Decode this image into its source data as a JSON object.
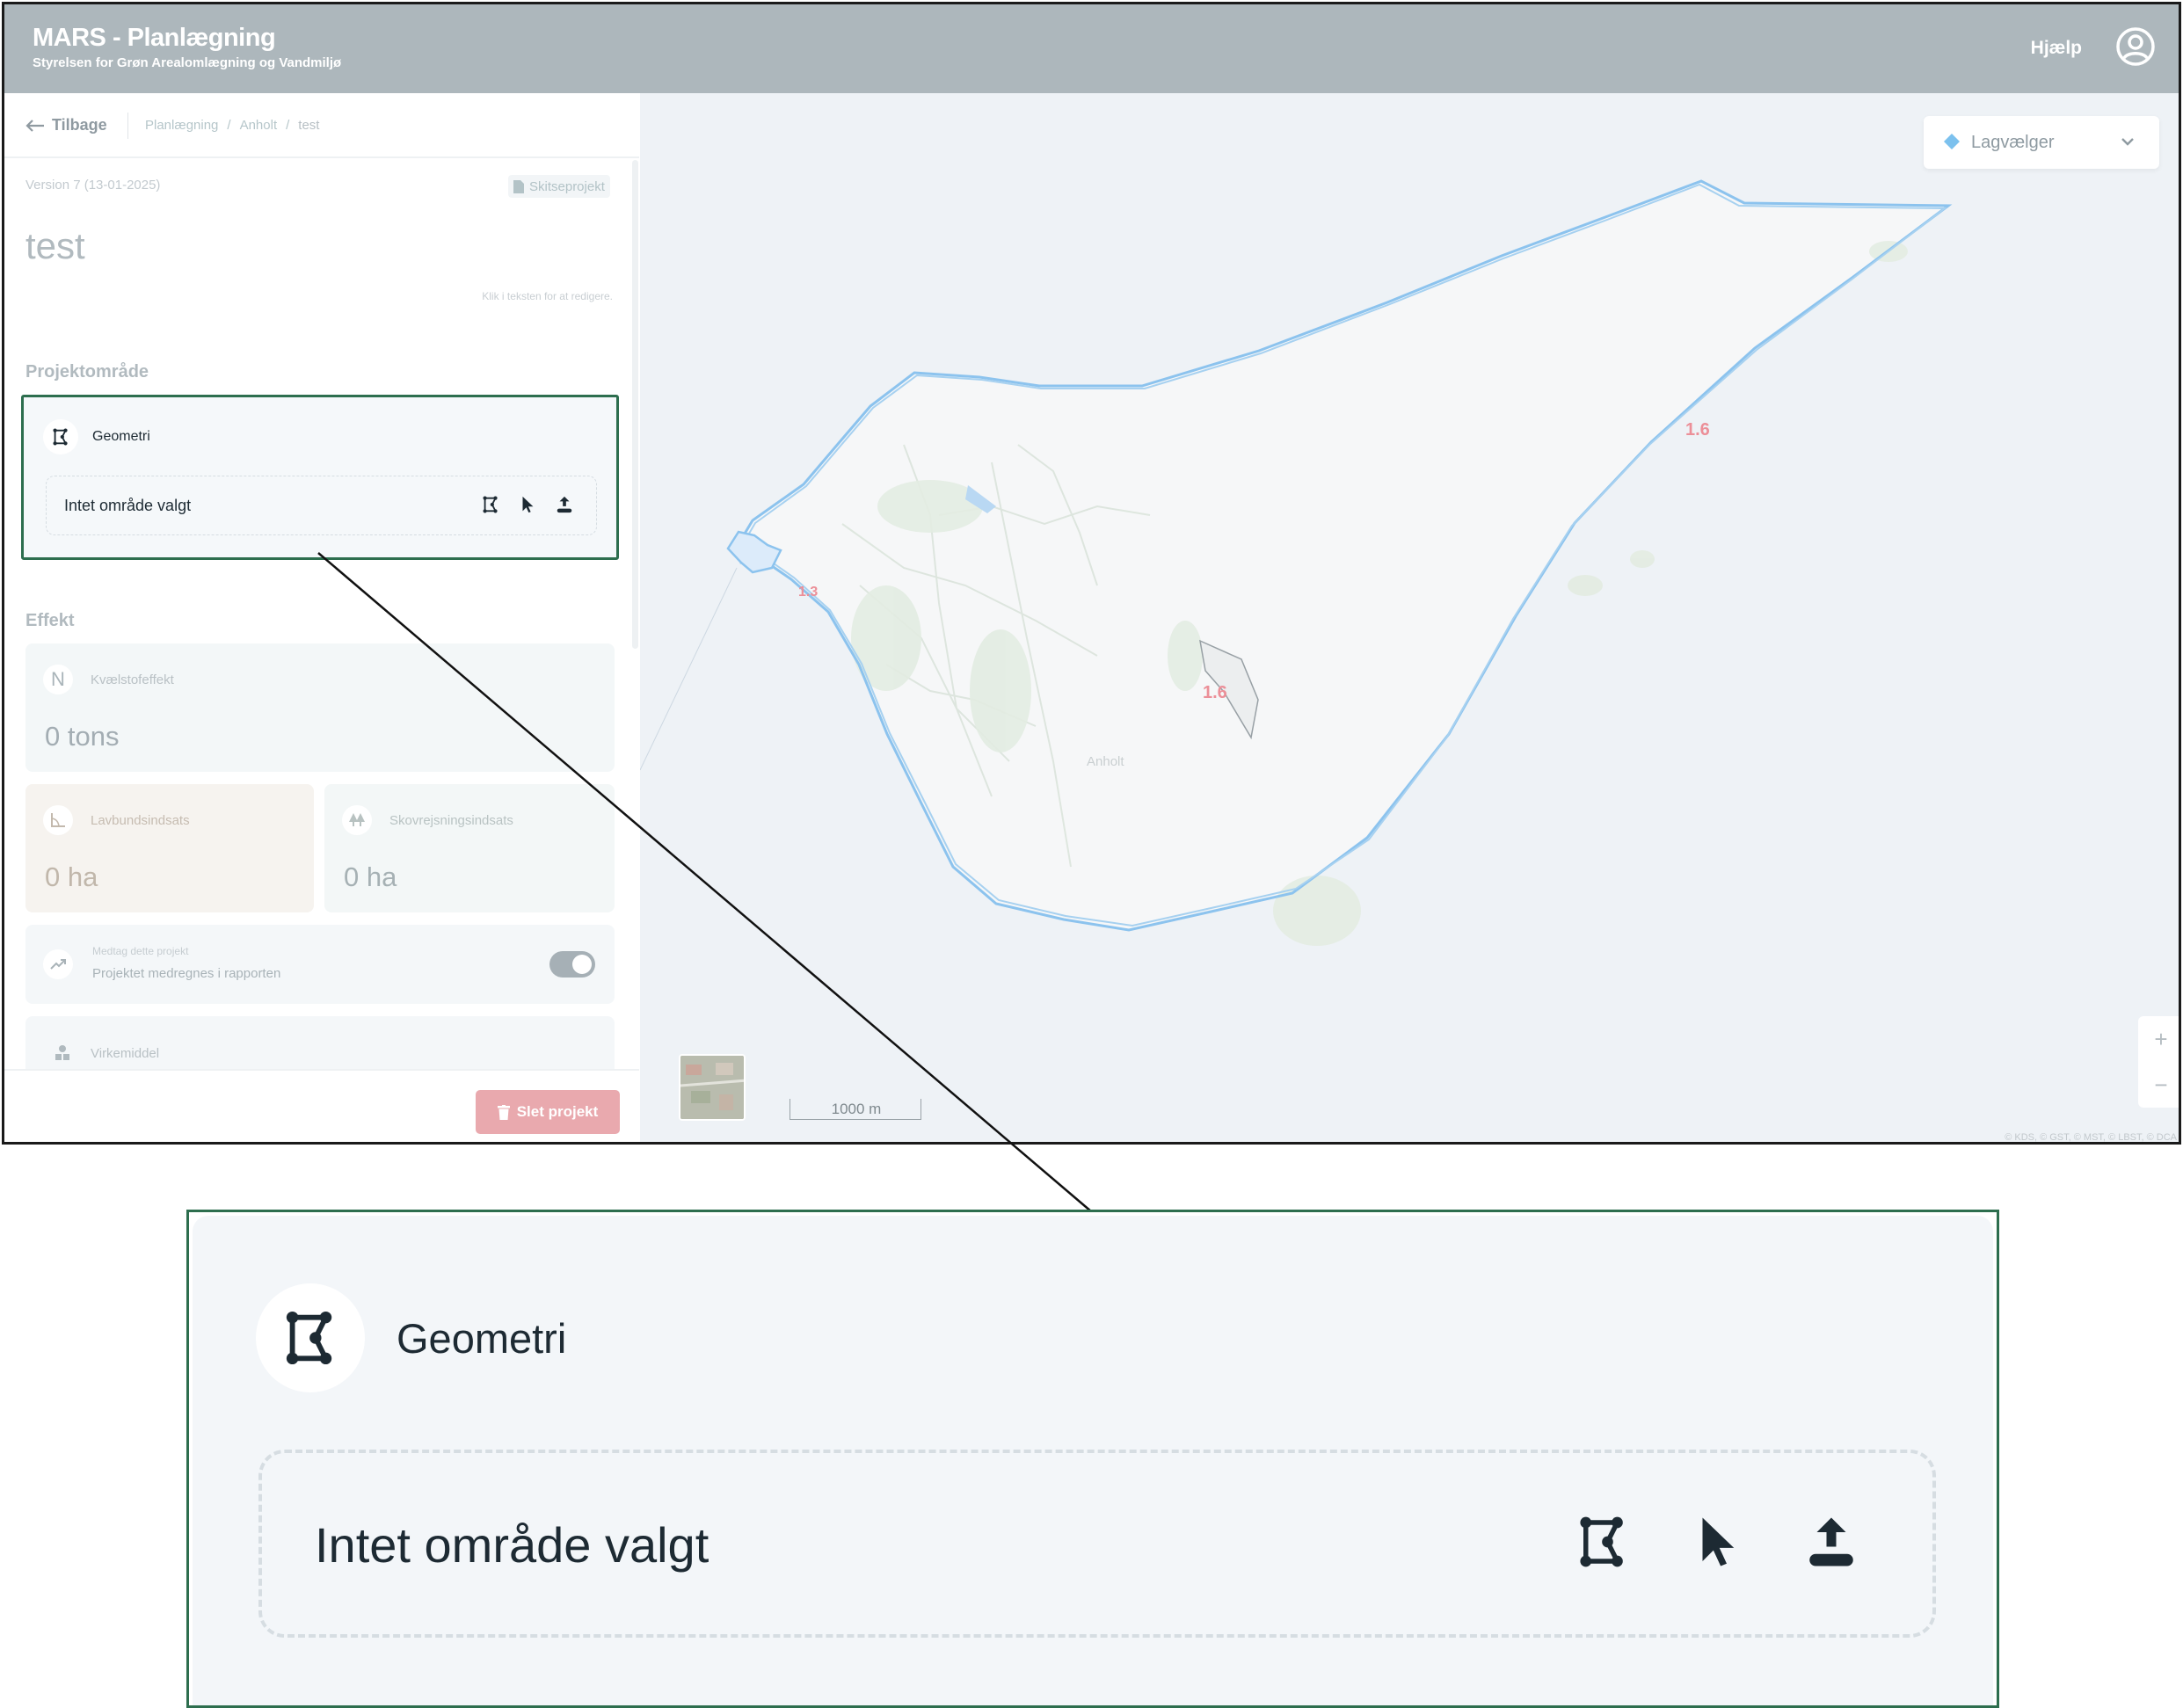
{
  "header": {
    "title": "MARS - Planlægning",
    "subtitle": "Styrelsen for Grøn Arealomlægning og Vandmiljø",
    "help": "Hjælp",
    "user_icon": "user-circle-icon"
  },
  "nav": {
    "back": "Tilbage",
    "breadcrumb": [
      "Planlægning",
      "Anholt",
      "test"
    ],
    "breadcrumb_separator": "/"
  },
  "project": {
    "version": "Version 7 (13-01-2025)",
    "badge": "Skitseprojekt",
    "name": "test",
    "edit_hint": "Klik i teksten for at redigere."
  },
  "area": {
    "section": "Projektområde",
    "title": "Geometri",
    "empty_text": "Intet område valgt",
    "tools": [
      "polygon-draw-icon",
      "pointer-select-icon",
      "upload-icon"
    ]
  },
  "effect": {
    "section": "Effekt",
    "nitrogen": {
      "icon": "N",
      "label": "Kvælstofeffekt",
      "value": "0 tons"
    },
    "lowland": {
      "label": "Lavbundsindsats",
      "value": "0 ha"
    },
    "afforestation": {
      "label": "Skovrejsningsindsats",
      "value": "0 ha"
    },
    "include": {
      "label": "Medtag dette projekt",
      "text": "Projektet medregnes i rapporten",
      "enabled": true
    },
    "measure": {
      "label": "Virkemiddel"
    }
  },
  "footer": {
    "delete": "Slet projekt"
  },
  "map": {
    "layer_picker": "Lagvælger",
    "labels": [
      "1.6",
      "1.6",
      "1.3"
    ],
    "town": "Anholt",
    "scale": "1000 m",
    "zoom_in": "+",
    "zoom_out": "−",
    "attribution": "© KDS, © GST, © MST, © LBST, © DCA"
  },
  "colors": {
    "header_bg": "#adb7bc",
    "accent_border": "#2d6e4e",
    "delete_bg": "#e9a9ae",
    "outline_blue": "#8cc3ee",
    "label_red": "#ec8f98"
  }
}
